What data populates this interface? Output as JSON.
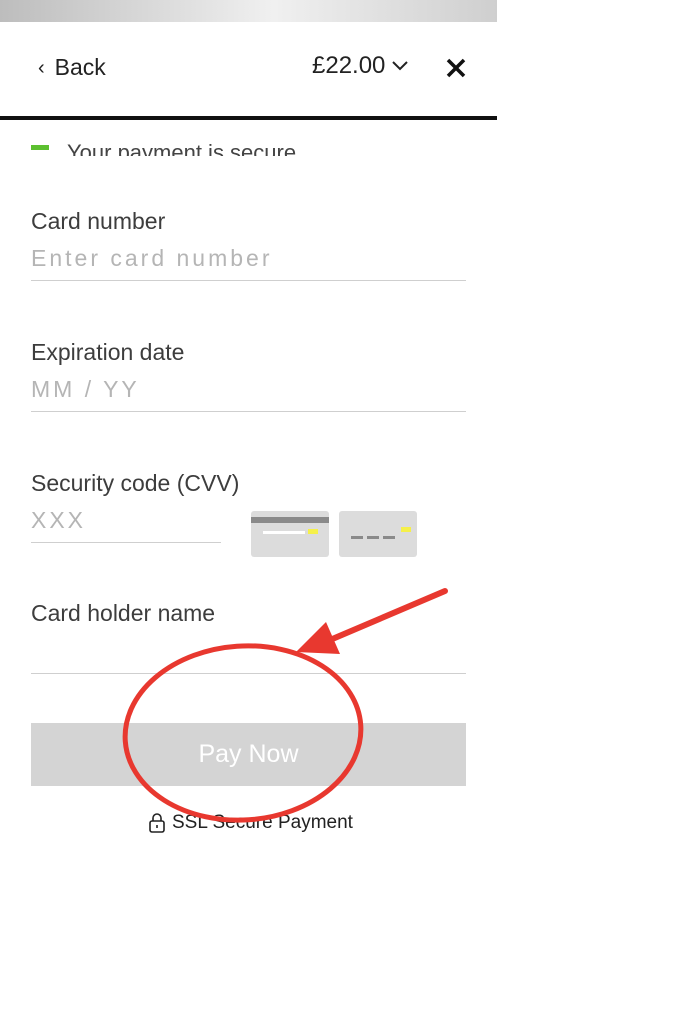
{
  "header": {
    "back_label": "Back",
    "amount": "£22.00"
  },
  "secure_notice": "Your payment is secure.",
  "form": {
    "card_number": {
      "label": "Card number",
      "placeholder": "Enter card number",
      "value": ""
    },
    "expiration": {
      "label": "Expiration date",
      "placeholder": "MM / YY",
      "value": ""
    },
    "cvv": {
      "label": "Security code (CVV)",
      "placeholder": "XXX",
      "value": ""
    },
    "holder": {
      "label": "Card holder name",
      "placeholder": "",
      "value": ""
    }
  },
  "pay_button": {
    "label": "Pay Now",
    "background": "#d4d4d4",
    "text_color": "#ffffff"
  },
  "ssl_label": "SSL Secure Payment",
  "icons": {
    "back": "chevron-left-icon",
    "amount_toggle": "chevron-down-icon",
    "close": "close-icon",
    "ssl": "lock-icon",
    "cvv_card_front": "card-front-icon",
    "cvv_card_back": "card-back-icon"
  },
  "colors": {
    "accent_green": "#5cc030",
    "annotation_red": "#e8382f"
  }
}
